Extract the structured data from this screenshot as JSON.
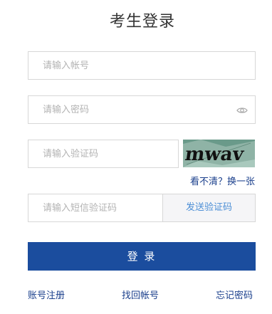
{
  "title": "考生登录",
  "account": {
    "placeholder": "请输入帐号",
    "value": ""
  },
  "password": {
    "placeholder": "请输入密码",
    "value": "",
    "icon": "eye-icon"
  },
  "captcha": {
    "placeholder": "请输入验证码",
    "value": "",
    "image_text": "mwav",
    "refresh_label": "看不清？换一张"
  },
  "sms": {
    "placeholder": "请输入短信验证码",
    "value": "",
    "send_label": "发送验证码"
  },
  "login_label": "登 录",
  "links": {
    "register": "账号注册",
    "find_account": "找回帐号",
    "forgot_password": "忘记密码"
  },
  "colors": {
    "primary": "#1b4d9e",
    "link": "#1a3f8c",
    "send_code": "#4d8fd6",
    "border": "#d7d7d7"
  }
}
